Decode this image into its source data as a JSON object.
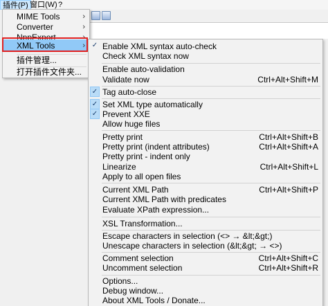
{
  "menubar": {
    "items": [
      "插件(P)",
      "窗口(W)",
      "?"
    ]
  },
  "plugins_menu": {
    "items": [
      {
        "label": "MIME Tools",
        "submenu": true
      },
      {
        "label": "Converter",
        "submenu": true
      },
      {
        "label": "NppExport",
        "submenu": true
      },
      {
        "label": "XML Tools",
        "submenu": true,
        "highlighted": true
      },
      {
        "label": "插件管理..."
      },
      {
        "label": "打开插件文件夹..."
      }
    ],
    "arrow": "›"
  },
  "xml_tools_menu": {
    "check_glyph": "✓",
    "items": {
      "enable_xml_syntax_auto_check": {
        "label": "Enable XML syntax auto-check",
        "checked": true
      },
      "check_xml_syntax_now": {
        "label": "Check XML syntax now"
      },
      "enable_auto_validation": {
        "label": "Enable auto-validation"
      },
      "validate_now": {
        "label": "Validate now",
        "shortcut": "Ctrl+Alt+Shift+M"
      },
      "tag_auto_close": {
        "label": "Tag auto-close",
        "checked": true
      },
      "set_xml_type_automatically": {
        "label": "Set XML type automatically",
        "checked": true
      },
      "prevent_xxe": {
        "label": "Prevent XXE",
        "checked": true
      },
      "allow_huge_files": {
        "label": "Allow huge files"
      },
      "pretty_print": {
        "label": "Pretty print",
        "shortcut": "Ctrl+Alt+Shift+B"
      },
      "pretty_print_indent_attributes": {
        "label": "Pretty print (indent attributes)",
        "shortcut": "Ctrl+Alt+Shift+A"
      },
      "pretty_print_indent_only": {
        "label": "Pretty print - indent only"
      },
      "linearize": {
        "label": "Linearize",
        "shortcut": "Ctrl+Alt+Shift+L"
      },
      "apply_to_all_open_files": {
        "label": "Apply to all open files"
      },
      "current_xml_path": {
        "label": "Current XML Path",
        "shortcut": "Ctrl+Alt+Shift+P"
      },
      "current_xml_path_with_predicates": {
        "label": "Current XML Path with predicates"
      },
      "evaluate_xpath_expression": {
        "label": "Evaluate XPath expression..."
      },
      "xsl_transformation": {
        "label": "XSL Transformation..."
      },
      "escape_characters_in_selection": {
        "label": "Escape characters in selection (<> → &lt;&gt;)"
      },
      "unescape_characters_in_selection": {
        "label": "Unescape characters in selection (&lt;&gt; → <>)"
      },
      "comment_selection": {
        "label": "Comment selection",
        "shortcut": "Ctrl+Alt+Shift+C"
      },
      "uncomment_selection": {
        "label": "Uncomment selection",
        "shortcut": "Ctrl+Alt+Shift+R"
      },
      "options": {
        "label": "Options..."
      },
      "debug_window": {
        "label": "Debug window..."
      },
      "about_xml_tools": {
        "label": "About XML Tools / Donate..."
      }
    }
  },
  "colors": {
    "menu_highlight": "#91c9f7",
    "check_background": "#b9dcf7",
    "annotation_box": "#e02020"
  }
}
